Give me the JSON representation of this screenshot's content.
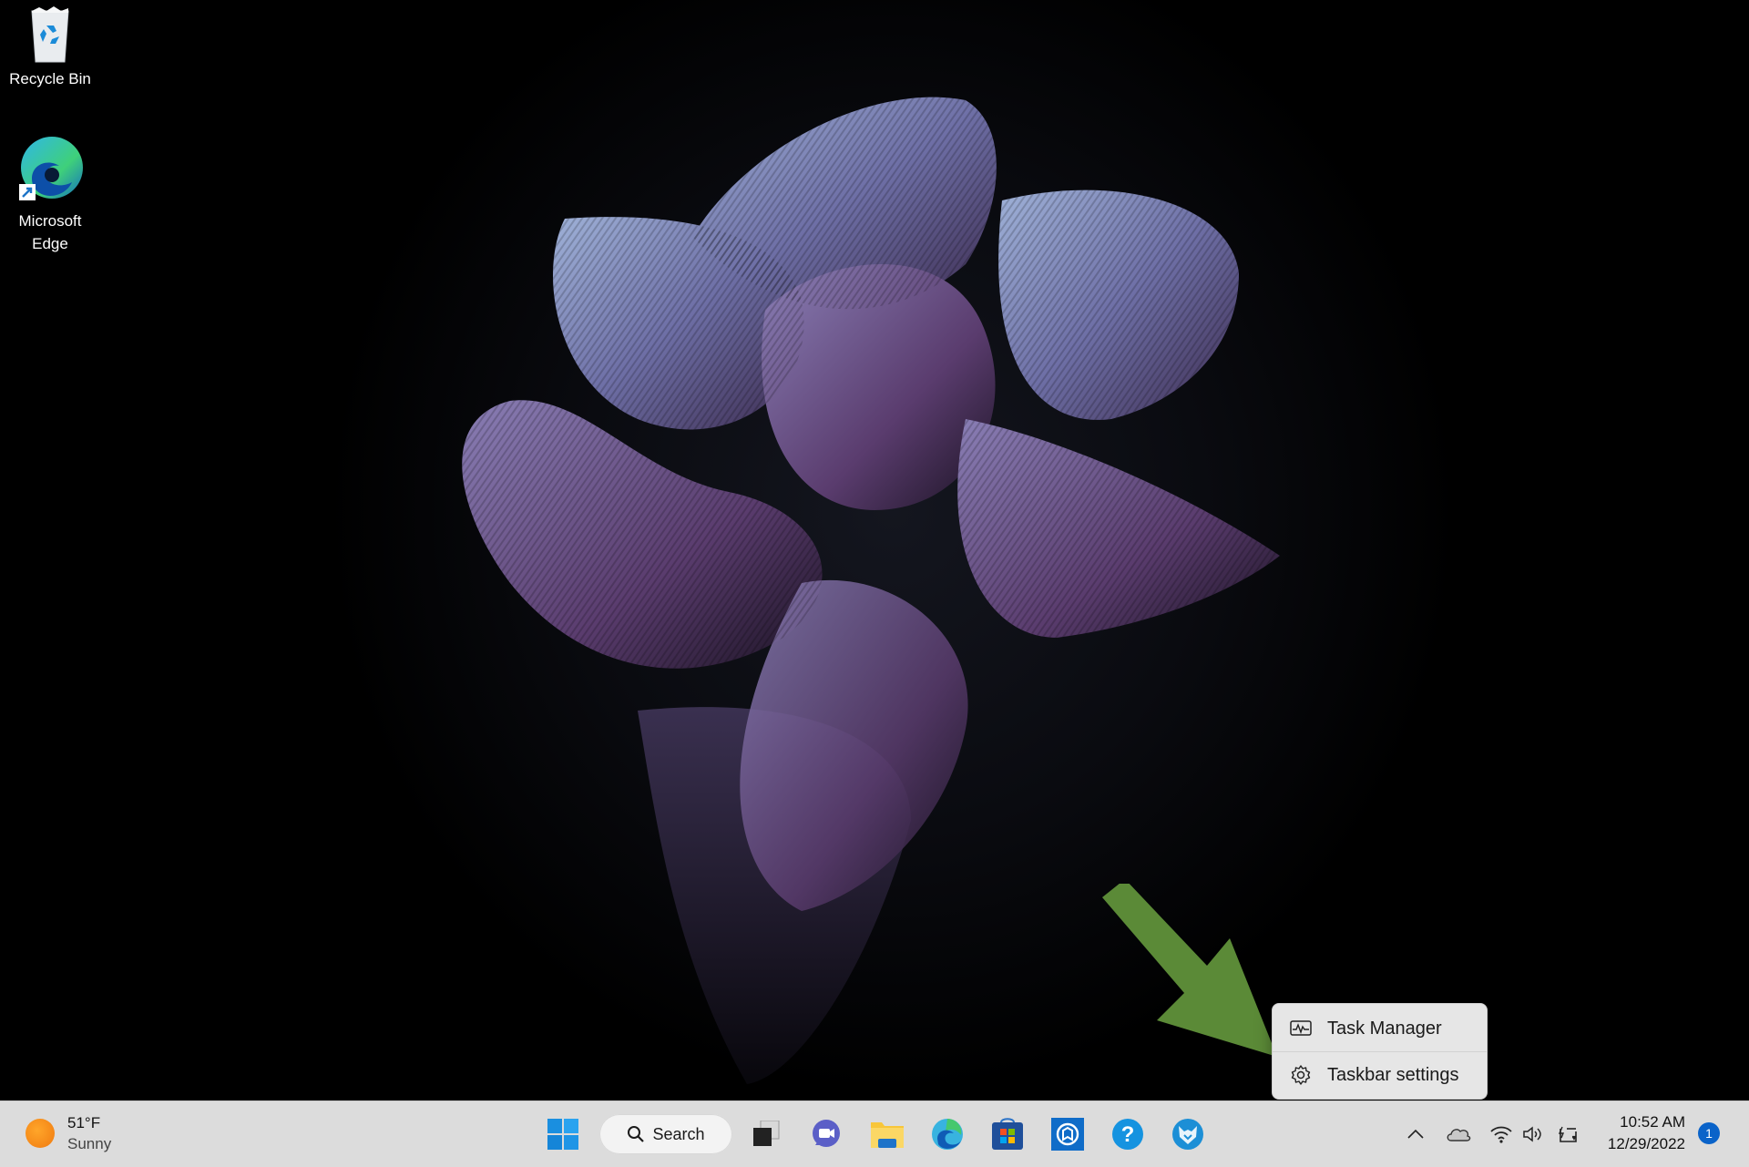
{
  "desktop": {
    "icons": [
      {
        "label": "Recycle Bin",
        "icon": "recycle-bin-icon"
      },
      {
        "label": "Microsoft Edge",
        "icon": "edge-icon",
        "shortcut": true
      }
    ],
    "annotation": {
      "type": "arrow",
      "color": "#5b8a37",
      "points_to": "context-menu"
    }
  },
  "context_menu": {
    "items": [
      {
        "label": "Task Manager",
        "icon": "task-manager-icon"
      },
      {
        "label": "Taskbar settings",
        "icon": "gear-icon"
      }
    ]
  },
  "taskbar": {
    "weather": {
      "temperature": "51°F",
      "condition": "Sunny",
      "icon": "sun-icon"
    },
    "start_icon": "windows-start-icon",
    "search": {
      "label": "Search",
      "icon": "search-icon"
    },
    "pinned": [
      {
        "name": "Task View",
        "icon": "task-view-icon"
      },
      {
        "name": "Chat",
        "icon": "teams-chat-icon"
      },
      {
        "name": "File Explorer",
        "icon": "file-explorer-icon"
      },
      {
        "name": "Microsoft Edge",
        "icon": "edge-icon"
      },
      {
        "name": "Microsoft Store",
        "icon": "store-icon"
      },
      {
        "name": "App",
        "icon": "app-icon"
      },
      {
        "name": "Get Help",
        "icon": "help-icon"
      },
      {
        "name": "App",
        "icon": "fox-app-icon"
      }
    ],
    "tray": {
      "icons": [
        "chevron-up-icon",
        "onedrive-icon",
        "wifi-icon",
        "volume-icon",
        "battery-charging-icon"
      ],
      "time": "10:52 AM",
      "date": "12/29/2022",
      "notification_count": "1"
    }
  },
  "colors": {
    "taskbar_bg": "#dcdcdc",
    "accent": "#0a63c9",
    "arrow": "#5b8a37"
  }
}
